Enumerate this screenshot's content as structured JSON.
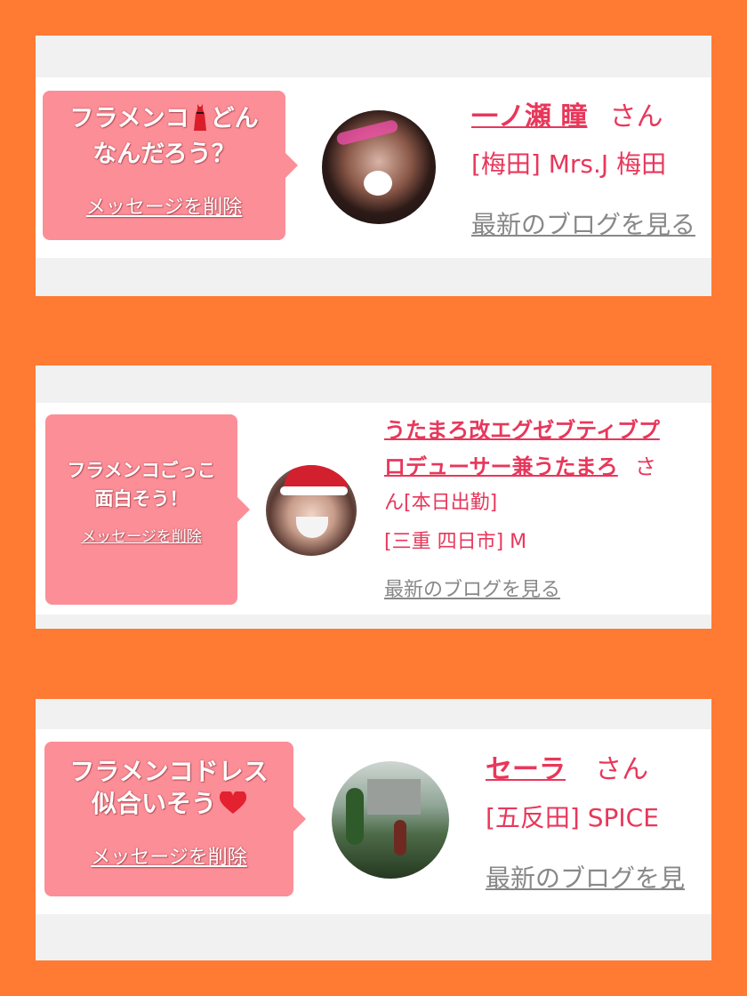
{
  "colors": {
    "background": "#ff7a33",
    "bubble": "#fb8e97",
    "accent": "#e8375b",
    "blog_link": "#888888"
  },
  "messages": [
    {
      "text_line1": "フラメンコ",
      "icon": "red-dress-icon",
      "text_line1_end": "どん",
      "text_line2": "なんだろう？",
      "delete_label": "メッセージを削除",
      "name": "一ノ瀬 瞳",
      "honorific": "さん",
      "shop": "[梅田] Mrs.J 梅田",
      "blog_link": "最新のブログを見る"
    },
    {
      "text_line1": "フラメンコごっこ",
      "text_line2": "面白そう！",
      "delete_label": "メッセージを削除",
      "name_line1": "うたまろ改エグゼブティブプ",
      "name_line2": "ロデューサー兼うたまろ",
      "honorific": "さ",
      "honorific_rest": "ん[本日出勤]",
      "shop": "[三重 四日市] M",
      "blog_link": "最新のブログを見る"
    },
    {
      "text_line1": "フラメンコドレス",
      "text_line2": "似合いそう",
      "icon": "heart-icon",
      "delete_label": "メッセージを削除",
      "name": "セーラ",
      "honorific": "さん",
      "shop": "[五反田] SPICE",
      "blog_link": "最新のブログを見"
    }
  ]
}
